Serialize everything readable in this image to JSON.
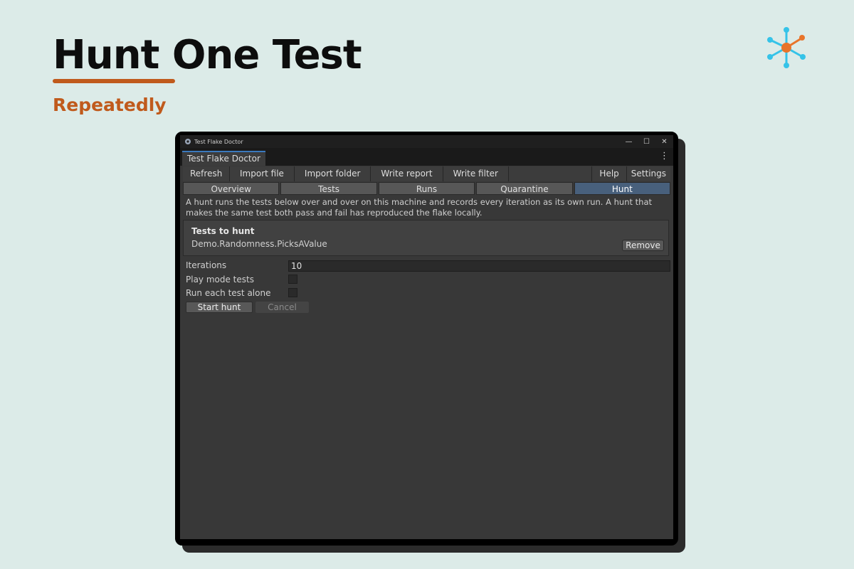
{
  "hero": {
    "title": "Hunt One Test",
    "subtitle": "Repeatedly"
  },
  "window": {
    "title": "Test Flake Doctor",
    "controls": {
      "minimize": "—",
      "maximize": "☐",
      "close": "✕"
    },
    "doc_tab": "Test Flake Doctor",
    "menu_icon": "⋮"
  },
  "toolbar": {
    "items": [
      "Refresh",
      "Import file",
      "Import folder",
      "Write report",
      "Write filter"
    ],
    "right_items": [
      "Help",
      "Settings"
    ]
  },
  "view_tabs": {
    "items": [
      "Overview",
      "Tests",
      "Runs",
      "Quarantine",
      "Hunt"
    ],
    "active": "Hunt"
  },
  "hunt": {
    "description": "A hunt runs the tests below over and over on this machine and records every iteration as its own run. A hunt that makes the same test both pass and fail has reproduced the flake locally.",
    "tests_box": {
      "title": "Tests to hunt",
      "item": "Demo.Randomness.PicksAValue",
      "remove_label": "Remove"
    },
    "iterations_label": "Iterations",
    "iterations_value": "10",
    "play_mode_label": "Play mode tests",
    "play_mode_checked": false,
    "run_alone_label": "Run each test alone",
    "run_alone_checked": false,
    "start_label": "Start hunt",
    "cancel_label": "Cancel"
  },
  "colors": {
    "accent": "#c05a1c",
    "background": "#dcebe8",
    "active_tab": "#48607c"
  }
}
